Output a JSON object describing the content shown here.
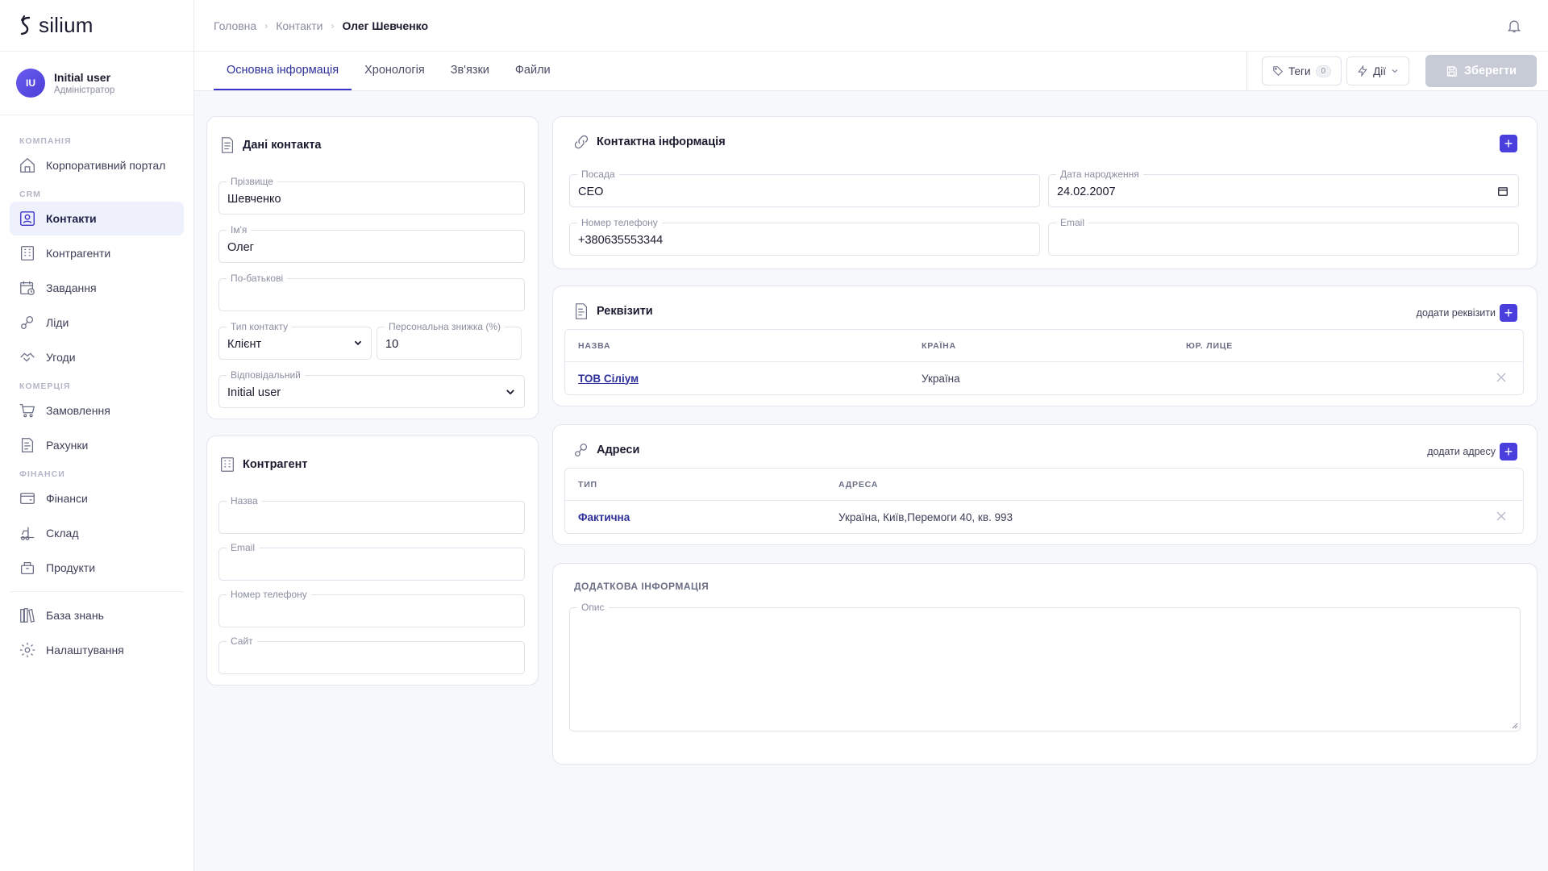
{
  "app": {
    "logo_text": "silium"
  },
  "user": {
    "initials": "IU",
    "name": "Initial user",
    "role": "Адміністратор"
  },
  "sidebar": {
    "sections": {
      "company": "КОМПАНІЯ",
      "crm": "CRM",
      "commerce": "КОМЕРЦІЯ",
      "finance": "ФІНАНСИ"
    },
    "items": {
      "portal": "Корпоративний портал",
      "contacts": "Контакти",
      "counterparties": "Контрагенти",
      "tasks": "Завдання",
      "leads": "Ліди",
      "deals": "Угоди",
      "orders": "Замовлення",
      "invoices": "Рахунки",
      "finances": "Фінанси",
      "warehouse": "Склад",
      "products": "Продукти",
      "knowledge": "База знань",
      "settings": "Налаштування"
    }
  },
  "breadcrumb": {
    "home": "Головна",
    "contacts": "Контакти",
    "current": "Олег Шевченко"
  },
  "tabs": {
    "main": "Основна інформація",
    "timeline": "Хронологія",
    "relations": "Зв'язки",
    "files": "Файли"
  },
  "actions": {
    "tags": "Теги",
    "tags_count": "0",
    "actions": "Дії",
    "save": "Зберегти"
  },
  "contact_data": {
    "title": "Дані контакта",
    "surname_label": "Прізвище",
    "surname": "Шевченко",
    "name_label": "Ім'я",
    "name": "Олег",
    "patronymic_label": "По-батькові",
    "patronymic": "",
    "type_label": "Тип контакту",
    "type": "Клієнт",
    "discount_label": "Персональна знижка (%)",
    "discount": "10",
    "responsible_label": "Відповідальний",
    "responsible": "Initial user"
  },
  "counterparty": {
    "title": "Контрагент",
    "name_label": "Назва",
    "email_label": "Email",
    "phone_label": "Номер телефону",
    "site_label": "Сайт"
  },
  "contact_info": {
    "title": "Контактна інформація",
    "position_label": "Посада",
    "position": "CEO",
    "birthdate_label": "Дата народження",
    "birthdate": "24.02.2007",
    "phone_label": "Номер телефону",
    "phone": "+380635553344",
    "email_label": "Email",
    "email": ""
  },
  "requisites": {
    "title": "Реквізити",
    "add_label": "додати реквізити",
    "columns": {
      "name": "НАЗВА",
      "country": "КРАЇНА",
      "legal": "ЮР. ЛИЦЕ"
    },
    "rows": [
      {
        "name": "ТОВ Сіліум",
        "country": "Україна",
        "legal": ""
      }
    ]
  },
  "addresses": {
    "title": "Адреси",
    "add_label": "додати адресу",
    "columns": {
      "type": "ТИП",
      "address": "АДРЕСА"
    },
    "rows": [
      {
        "type": "Фактична",
        "address": "Україна, Київ,Перемоги 40, кв. 993"
      }
    ]
  },
  "additional": {
    "title": "ДОДАТКОВА ІНФОРМАЦІЯ",
    "description_label": "Опис",
    "description": ""
  },
  "colors": {
    "accent": "#4a3fdc",
    "active_bg": "#eef0fb",
    "save_disabled": "#c7cbd6"
  }
}
